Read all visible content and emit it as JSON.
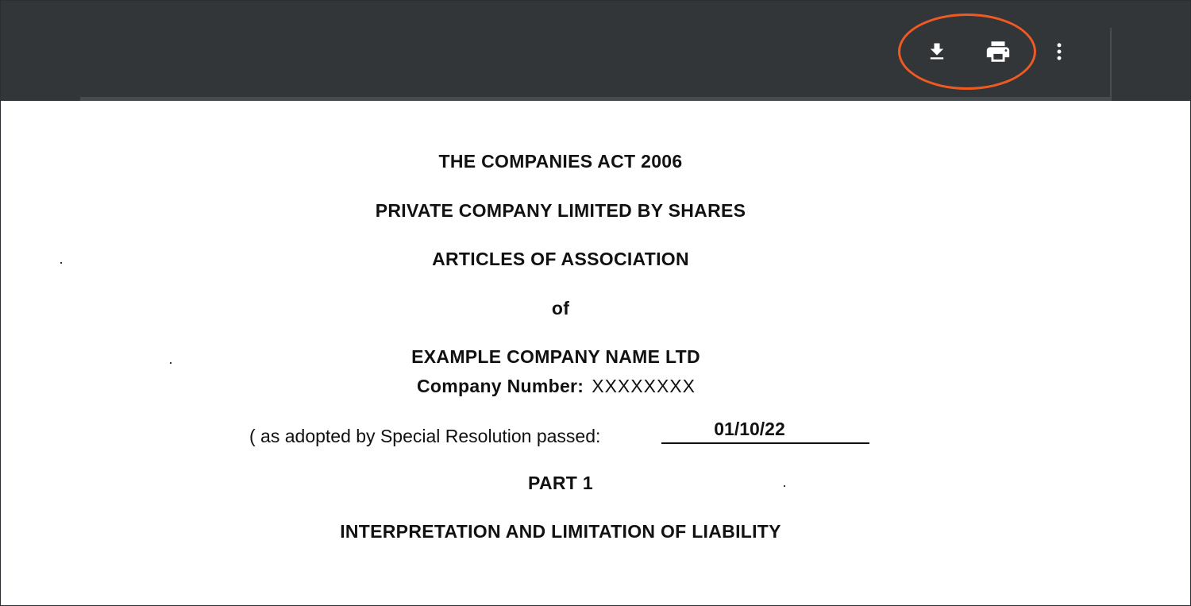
{
  "toolbar": {
    "buttons": [
      {
        "name": "download",
        "icon": "download-icon"
      },
      {
        "name": "print",
        "icon": "print-icon"
      },
      {
        "name": "more",
        "icon": "more-vert-icon"
      }
    ],
    "background_color": "#323639",
    "icon_color": "#ffffff",
    "highlight_color": "#ee5a22"
  },
  "document": {
    "act": "THE COMPANIES ACT 2006",
    "company_type": "PRIVATE COMPANY LIMITED BY SHARES",
    "doc_title": "ARTICLES OF ASSOCIATION",
    "of": "of",
    "company_name": "EXAMPLE COMPANY NAME LTD",
    "company_number_label": "Company Number:",
    "company_number_value": "XXXXXXXX",
    "resolution_text": "( as adopted by Special Resolution passed:",
    "resolution_date": "01/10/22",
    "part": "PART 1",
    "section_heading": "INTERPRETATION AND LIMITATION OF LIABILITY"
  }
}
